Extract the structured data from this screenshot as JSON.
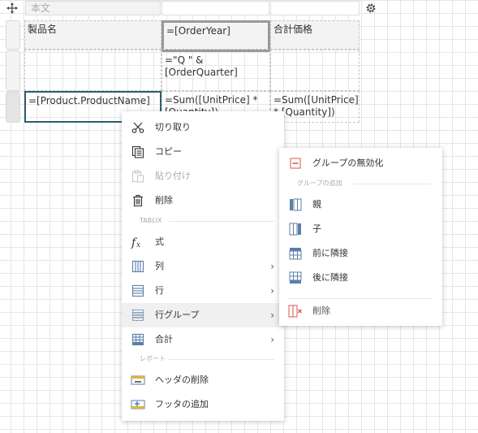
{
  "toolbar": {
    "body_label": "本文"
  },
  "table": {
    "header": {
      "name": "製品名",
      "year": "=[OrderYear]",
      "total": "合計価格"
    },
    "row2": {
      "quarter": "=\"Q \" &\n[OrderQuarter]"
    },
    "row3": {
      "name": "=[Product.ProductName]",
      "qty": "=Sum([UnitPrice] *\n[Quantity])",
      "total": "=Sum([UnitPrice]\n* [Quantity])"
    }
  },
  "context_menu": {
    "cut": "切り取り",
    "copy": "コピー",
    "paste": "貼り付け",
    "delete": "削除",
    "section_tablix": "TABLIX",
    "expression": "式",
    "column": "列",
    "row": "行",
    "row_group": "行グループ",
    "total": "合計",
    "section_report": "レポート",
    "remove_header": "ヘッダの削除",
    "add_footer": "フッタの追加",
    "chevron": "›"
  },
  "submenu": {
    "disable_group": "グループの無効化",
    "section_add_group": "グループの追加",
    "parent": "親",
    "child": "子",
    "adjacent_before": "前に隣接",
    "adjacent_after": "後に隣接",
    "delete": "削除"
  },
  "colors": {
    "accent": "#2e5d73",
    "icon_blue": "#5b7fa8",
    "delete_red": "#d9534f"
  }
}
